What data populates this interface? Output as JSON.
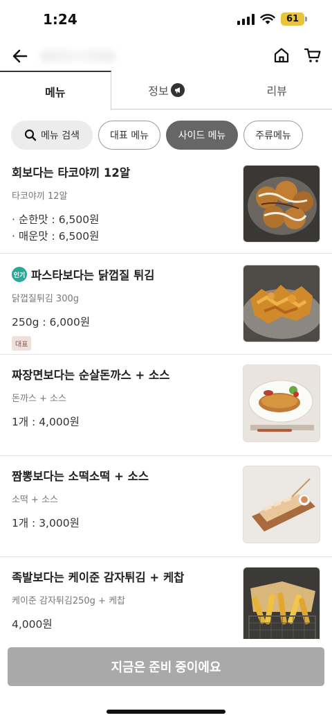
{
  "status_bar": {
    "time": "1:24",
    "battery": "61",
    "battery_color": "#e9c33b"
  },
  "nav": {
    "back_icon": "arrow-left-icon",
    "home_icon": "home-icon",
    "cart_icon": "cart-icon"
  },
  "tabs": [
    {
      "label": "메뉴",
      "active": true
    },
    {
      "label": "정보",
      "active": false,
      "icon": "megaphone-icon"
    },
    {
      "label": "리뷰",
      "active": false
    }
  ],
  "filters": {
    "search_label": "메뉴 검색",
    "chips": [
      {
        "label": "대표 메뉴",
        "selected": false
      },
      {
        "label": "사이드 메뉴",
        "selected": true
      },
      {
        "label": "주류메뉴",
        "selected": false
      }
    ]
  },
  "menu": [
    {
      "name": "회보다는 타코야끼 12알",
      "desc": "타코야끼 12알",
      "prices": [
        "· 순한맛 : 6,500원",
        "· 매운맛 : 6,500원"
      ],
      "popular": false,
      "tag": ""
    },
    {
      "name": "파스타보다는 닭껍질 튀김",
      "desc": "닭껍질튀김 300g",
      "prices": [
        "250g : 6,000원"
      ],
      "popular": true,
      "popular_label": "인기",
      "tag": "대표"
    },
    {
      "name": "짜장면보다는 순살돈까스 + 소스",
      "desc": "돈까스 + 소스",
      "prices": [
        "1개 : 4,000원"
      ],
      "popular": false,
      "tag": ""
    },
    {
      "name": "짬뽕보다는 소떡소떡 + 소스",
      "desc": "소떡 + 소스",
      "prices": [
        "1개 : 3,000원"
      ],
      "popular": false,
      "tag": ""
    },
    {
      "name": "족발보다는 케이준 감자튀김 + 케찹",
      "desc": "케이준 감자튀김250g + 케찹",
      "prices": [
        "4,000원"
      ],
      "popular": false,
      "tag": ""
    }
  ],
  "bottom": {
    "button_label": "지금은 준비 중이에요"
  },
  "colors": {
    "accent_teal": "#2aa89b",
    "disabled_button": "#a9a9a9",
    "selected_chip": "#666666"
  }
}
